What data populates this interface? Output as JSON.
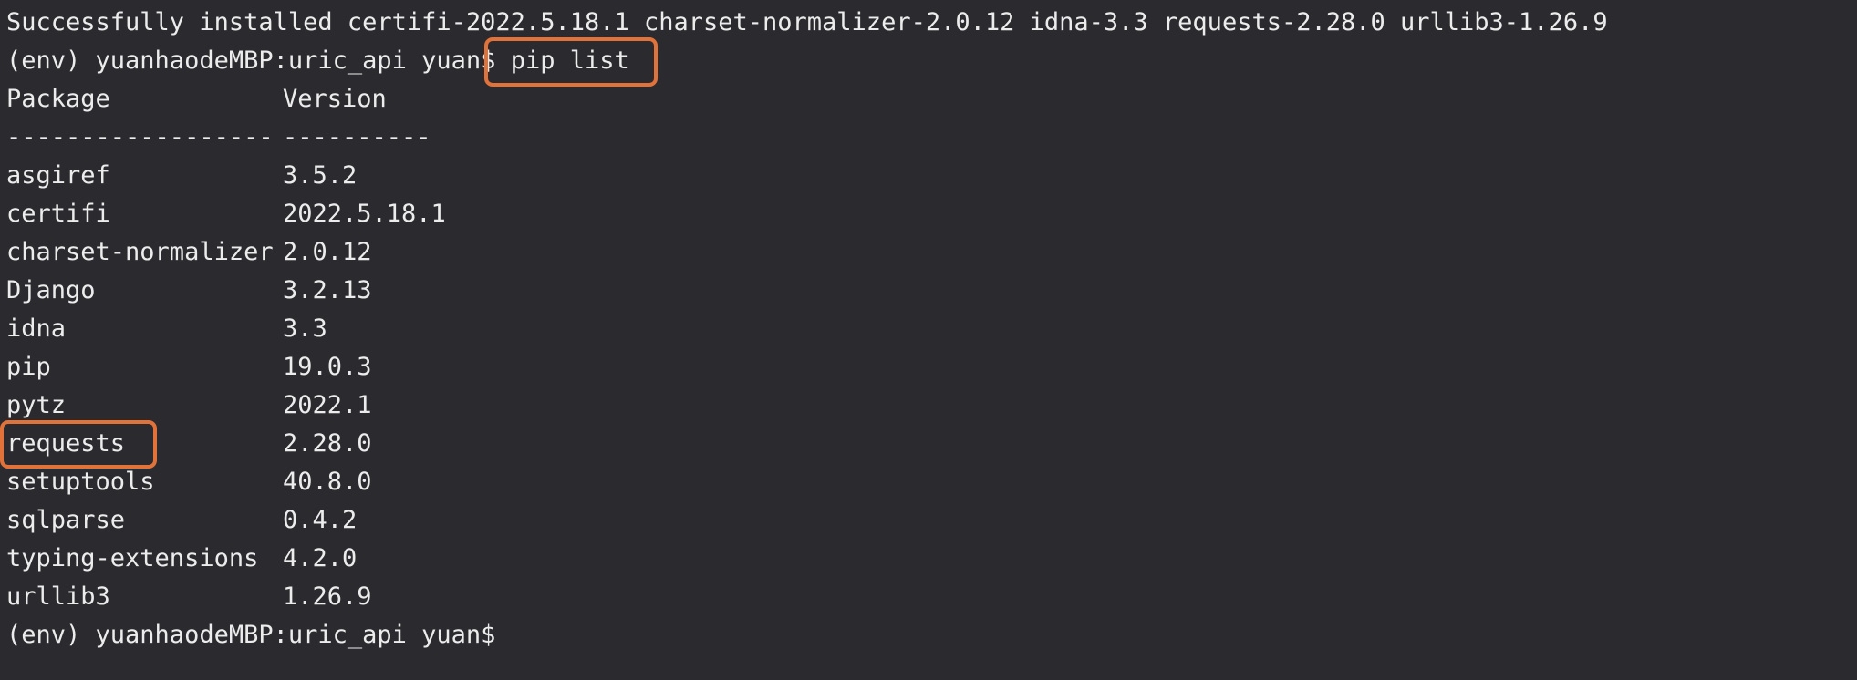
{
  "terminal": {
    "install_output": "Successfully installed certifi-2022.5.18.1 charset-normalizer-2.0.12 idna-3.3 requests-2.28.0 urllib3-1.26.9",
    "prompt": "(env) yuanhaodeMBP:uric_api yuan$",
    "command": "pip list",
    "table": {
      "header_package": "Package",
      "header_version": "Version",
      "rule_package": "------------------",
      "rule_version": "----------",
      "rows": [
        {
          "package": "asgiref",
          "version": "3.5.2"
        },
        {
          "package": "certifi",
          "version": "2022.5.18.1"
        },
        {
          "package": "charset-normalizer",
          "version": "2.0.12"
        },
        {
          "package": "Django",
          "version": "3.2.13"
        },
        {
          "package": "idna",
          "version": "3.3"
        },
        {
          "package": "pip",
          "version": "19.0.3"
        },
        {
          "package": "pytz",
          "version": "2022.1"
        },
        {
          "package": "requests",
          "version": "2.28.0"
        },
        {
          "package": "setuptools",
          "version": "40.8.0"
        },
        {
          "package": "sqlparse",
          "version": "0.4.2"
        },
        {
          "package": "typing-extensions",
          "version": "4.2.0"
        },
        {
          "package": "urllib3",
          "version": "1.26.9"
        }
      ]
    },
    "final_prompt": "(env) yuanhaodeMBP:uric_api yuan$"
  },
  "colors": {
    "background": "#2b2a2f",
    "text": "#ececec",
    "highlight": "#e0723a"
  }
}
